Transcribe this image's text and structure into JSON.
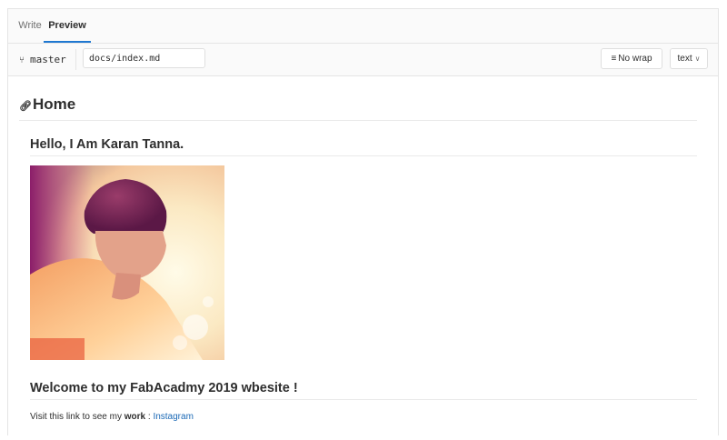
{
  "tabs": {
    "write": "Write",
    "preview": "Preview"
  },
  "toolbar": {
    "branch": "master",
    "file_path": "docs/index.md",
    "wrap_label": "No wrap",
    "language": "text"
  },
  "content": {
    "h1": "Home",
    "h2_intro": "Hello, I Am Karan Tanna.",
    "h2_welcome": "Welcome to my FabAcadmy 2019 wbesite !",
    "para_prefix": "Visit this link to see my ",
    "para_bold": "work",
    "para_sep": " : ",
    "para_link": "Instagram"
  },
  "icons": {
    "branch": "branch-icon",
    "link": "link-icon",
    "wrap": "wrap-lines-icon",
    "caret": "chevron-down-icon"
  },
  "colors": {
    "accent": "#1f78d1",
    "link": "#1b69b6"
  }
}
